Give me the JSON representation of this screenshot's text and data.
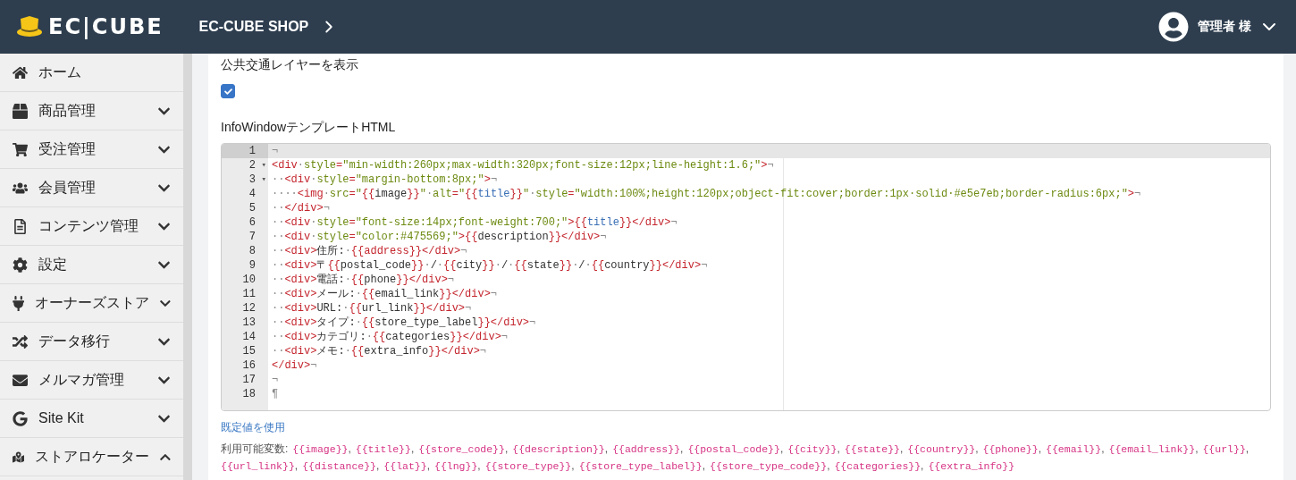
{
  "header": {
    "logo": "EC|CUBE",
    "shop_name": "EC-CUBE SHOP",
    "user": "管理者 様"
  },
  "sidebar": {
    "items": [
      {
        "label": "ホーム",
        "kind": "link"
      },
      {
        "label": "商品管理",
        "kind": "menu",
        "expanded": false
      },
      {
        "label": "受注管理",
        "kind": "menu",
        "expanded": false
      },
      {
        "label": "会員管理",
        "kind": "menu",
        "expanded": false
      },
      {
        "label": "コンテンツ管理",
        "kind": "menu",
        "expanded": false
      },
      {
        "label": "設定",
        "kind": "menu",
        "expanded": false
      },
      {
        "label": "オーナーズストア",
        "kind": "menu",
        "expanded": false
      },
      {
        "label": "データ移行",
        "kind": "menu",
        "expanded": false
      },
      {
        "label": "メルマガ管理",
        "kind": "menu",
        "expanded": false
      },
      {
        "label": "Site Kit",
        "kind": "menu",
        "expanded": false
      },
      {
        "label": "ストアロケーター",
        "kind": "menu",
        "expanded": true
      }
    ]
  },
  "form": {
    "transit_layer": {
      "label": "公共交通レイヤーを表示",
      "checked": true
    },
    "template": {
      "label": "InfoWindowテンプレートHTML",
      "lines": [
        {
          "number": "1",
          "fold": false,
          "active": true,
          "tokens": [
            {
              "kind": "ws",
              "text": "¬"
            }
          ]
        },
        {
          "number": "2",
          "fold": true,
          "active": false,
          "tokens": [
            {
              "kind": "tag",
              "text": "<div"
            },
            {
              "kind": "ws",
              "text": "·"
            },
            {
              "kind": "attr",
              "text": "style"
            },
            {
              "kind": "tag",
              "text": "="
            },
            {
              "kind": "str",
              "text": "\"min-width:260px;max-width:320px;font-size:12px;line-height:1.6;\""
            },
            {
              "kind": "tag",
              "text": ">"
            },
            {
              "kind": "ws",
              "text": "¬"
            }
          ]
        },
        {
          "number": "3",
          "fold": true,
          "active": false,
          "tokens": [
            {
              "kind": "ws",
              "text": "··"
            },
            {
              "kind": "tag",
              "text": "<div"
            },
            {
              "kind": "ws",
              "text": "·"
            },
            {
              "kind": "attr",
              "text": "style"
            },
            {
              "kind": "tag",
              "text": "="
            },
            {
              "kind": "str",
              "text": "\"margin-bottom:8px;\""
            },
            {
              "kind": "tag",
              "text": ">"
            },
            {
              "kind": "ws",
              "text": "¬"
            }
          ]
        },
        {
          "number": "4",
          "fold": false,
          "active": false,
          "tokens": [
            {
              "kind": "ws",
              "text": "····"
            },
            {
              "kind": "tag",
              "text": "<img"
            },
            {
              "kind": "ws",
              "text": "·"
            },
            {
              "kind": "attr",
              "text": "src"
            },
            {
              "kind": "tag",
              "text": "="
            },
            {
              "kind": "str",
              "text": "\""
            },
            {
              "kind": "tag",
              "text": "{{"
            },
            {
              "kind": "text",
              "text": "image"
            },
            {
              "kind": "tag",
              "text": "}}"
            },
            {
              "kind": "str",
              "text": "\""
            },
            {
              "kind": "ws",
              "text": "·"
            },
            {
              "kind": "attr",
              "text": "alt"
            },
            {
              "kind": "tag",
              "text": "="
            },
            {
              "kind": "str",
              "text": "\""
            },
            {
              "kind": "tag",
              "text": "{{"
            },
            {
              "kind": "var",
              "text": "title"
            },
            {
              "kind": "tag",
              "text": "}}"
            },
            {
              "kind": "str",
              "text": "\""
            },
            {
              "kind": "ws",
              "text": "·"
            },
            {
              "kind": "attr",
              "text": "style"
            },
            {
              "kind": "tag",
              "text": "="
            },
            {
              "kind": "str",
              "text": "\"width:100%;height:120px;object-fit:cover;border:1px·solid·#e5e7eb;border-radius:6px;\""
            },
            {
              "kind": "tag",
              "text": ">"
            },
            {
              "kind": "ws",
              "text": "¬"
            }
          ]
        },
        {
          "number": "5",
          "fold": false,
          "active": false,
          "tokens": [
            {
              "kind": "ws",
              "text": "··"
            },
            {
              "kind": "tag",
              "text": "</div>"
            },
            {
              "kind": "ws",
              "text": "¬"
            }
          ]
        },
        {
          "number": "6",
          "fold": false,
          "active": false,
          "tokens": [
            {
              "kind": "ws",
              "text": "··"
            },
            {
              "kind": "tag",
              "text": "<div"
            },
            {
              "kind": "ws",
              "text": "·"
            },
            {
              "kind": "attr",
              "text": "style"
            },
            {
              "kind": "tag",
              "text": "="
            },
            {
              "kind": "str",
              "text": "\"font-size:14px;font-weight:700;\""
            },
            {
              "kind": "tag",
              "text": ">{{"
            },
            {
              "kind": "var",
              "text": "title"
            },
            {
              "kind": "tag",
              "text": "}}</div>"
            },
            {
              "kind": "ws",
              "text": "¬"
            }
          ]
        },
        {
          "number": "7",
          "fold": false,
          "active": false,
          "tokens": [
            {
              "kind": "ws",
              "text": "··"
            },
            {
              "kind": "tag",
              "text": "<div"
            },
            {
              "kind": "ws",
              "text": "·"
            },
            {
              "kind": "attr",
              "text": "style"
            },
            {
              "kind": "tag",
              "text": "="
            },
            {
              "kind": "str",
              "text": "\"color:#475569;\""
            },
            {
              "kind": "tag",
              "text": ">{{"
            },
            {
              "kind": "text",
              "text": "description"
            },
            {
              "kind": "tag",
              "text": "}}</div>"
            },
            {
              "kind": "ws",
              "text": "¬"
            }
          ]
        },
        {
          "number": "8",
          "fold": false,
          "active": false,
          "tokens": [
            {
              "kind": "ws",
              "text": "··"
            },
            {
              "kind": "tag",
              "text": "<div>"
            },
            {
              "kind": "text",
              "text": "住所:"
            },
            {
              "kind": "ws",
              "text": "·"
            },
            {
              "kind": "tag",
              "text": "{{address}}</div>"
            },
            {
              "kind": "ws",
              "text": "¬"
            }
          ]
        },
        {
          "number": "9",
          "fold": false,
          "active": false,
          "tokens": [
            {
              "kind": "ws",
              "text": "··"
            },
            {
              "kind": "tag",
              "text": "<div>"
            },
            {
              "kind": "text",
              "text": "〒"
            },
            {
              "kind": "tag",
              "text": "{{"
            },
            {
              "kind": "text",
              "text": "postal_code"
            },
            {
              "kind": "tag",
              "text": "}}"
            },
            {
              "kind": "ws",
              "text": "·"
            },
            {
              "kind": "text",
              "text": "/"
            },
            {
              "kind": "ws",
              "text": "·"
            },
            {
              "kind": "tag",
              "text": "{{"
            },
            {
              "kind": "text",
              "text": "city"
            },
            {
              "kind": "tag",
              "text": "}}"
            },
            {
              "kind": "ws",
              "text": "·"
            },
            {
              "kind": "text",
              "text": "/"
            },
            {
              "kind": "ws",
              "text": "·"
            },
            {
              "kind": "tag",
              "text": "{{"
            },
            {
              "kind": "text",
              "text": "state"
            },
            {
              "kind": "tag",
              "text": "}}"
            },
            {
              "kind": "ws",
              "text": "·"
            },
            {
              "kind": "text",
              "text": "/"
            },
            {
              "kind": "ws",
              "text": "·"
            },
            {
              "kind": "tag",
              "text": "{{"
            },
            {
              "kind": "text",
              "text": "country"
            },
            {
              "kind": "tag",
              "text": "}}</div>"
            },
            {
              "kind": "ws",
              "text": "¬"
            }
          ]
        },
        {
          "number": "10",
          "fold": false,
          "active": false,
          "tokens": [
            {
              "kind": "ws",
              "text": "··"
            },
            {
              "kind": "tag",
              "text": "<div>"
            },
            {
              "kind": "text",
              "text": "電話:"
            },
            {
              "kind": "ws",
              "text": "·"
            },
            {
              "kind": "tag",
              "text": "{{"
            },
            {
              "kind": "text",
              "text": "phone"
            },
            {
              "kind": "tag",
              "text": "}}</div>"
            },
            {
              "kind": "ws",
              "text": "¬"
            }
          ]
        },
        {
          "number": "11",
          "fold": false,
          "active": false,
          "tokens": [
            {
              "kind": "ws",
              "text": "··"
            },
            {
              "kind": "tag",
              "text": "<div>"
            },
            {
              "kind": "text",
              "text": "メール:"
            },
            {
              "kind": "ws",
              "text": "·"
            },
            {
              "kind": "tag",
              "text": "{{"
            },
            {
              "kind": "text",
              "text": "email_link"
            },
            {
              "kind": "tag",
              "text": "}}</div>"
            },
            {
              "kind": "ws",
              "text": "¬"
            }
          ]
        },
        {
          "number": "12",
          "fold": false,
          "active": false,
          "tokens": [
            {
              "kind": "ws",
              "text": "··"
            },
            {
              "kind": "tag",
              "text": "<div>"
            },
            {
              "kind": "text",
              "text": "URL:"
            },
            {
              "kind": "ws",
              "text": "·"
            },
            {
              "kind": "tag",
              "text": "{{"
            },
            {
              "kind": "text",
              "text": "url_link"
            },
            {
              "kind": "tag",
              "text": "}}</div>"
            },
            {
              "kind": "ws",
              "text": "¬"
            }
          ]
        },
        {
          "number": "13",
          "fold": false,
          "active": false,
          "tokens": [
            {
              "kind": "ws",
              "text": "··"
            },
            {
              "kind": "tag",
              "text": "<div>"
            },
            {
              "kind": "text",
              "text": "タイプ:"
            },
            {
              "kind": "ws",
              "text": "·"
            },
            {
              "kind": "tag",
              "text": "{{"
            },
            {
              "kind": "text",
              "text": "store_type_label"
            },
            {
              "kind": "tag",
              "text": "}}</div>"
            },
            {
              "kind": "ws",
              "text": "¬"
            }
          ]
        },
        {
          "number": "14",
          "fold": false,
          "active": false,
          "tokens": [
            {
              "kind": "ws",
              "text": "··"
            },
            {
              "kind": "tag",
              "text": "<div>"
            },
            {
              "kind": "text",
              "text": "カテゴリ:"
            },
            {
              "kind": "ws",
              "text": "·"
            },
            {
              "kind": "tag",
              "text": "{{"
            },
            {
              "kind": "text",
              "text": "categories"
            },
            {
              "kind": "tag",
              "text": "}}</div>"
            },
            {
              "kind": "ws",
              "text": "¬"
            }
          ]
        },
        {
          "number": "15",
          "fold": false,
          "active": false,
          "tokens": [
            {
              "kind": "ws",
              "text": "··"
            },
            {
              "kind": "tag",
              "text": "<div>"
            },
            {
              "kind": "text",
              "text": "メモ:"
            },
            {
              "kind": "ws",
              "text": "·"
            },
            {
              "kind": "tag",
              "text": "{{"
            },
            {
              "kind": "text",
              "text": "extra_info"
            },
            {
              "kind": "tag",
              "text": "}}</div>"
            },
            {
              "kind": "ws",
              "text": "¬"
            }
          ]
        },
        {
          "number": "16",
          "fold": false,
          "active": false,
          "tokens": [
            {
              "kind": "tag",
              "text": "</div>"
            },
            {
              "kind": "ws",
              "text": "¬"
            }
          ]
        },
        {
          "number": "17",
          "fold": false,
          "active": false,
          "tokens": [
            {
              "kind": "ws",
              "text": "¬"
            }
          ]
        },
        {
          "number": "18",
          "fold": false,
          "active": false,
          "tokens": [
            {
              "kind": "ws",
              "text": "¶"
            }
          ]
        }
      ],
      "fold_marker": "▾",
      "reset_link": "既定値を使用",
      "separator": ",",
      "variables_label": "利用可能変数:",
      "variables": [
        "{{image}}",
        "{{title}}",
        "{{store_code}}",
        "{{description}}",
        "{{address}}",
        "{{postal_code}}",
        "{{city}}",
        "{{state}}",
        "{{country}}",
        "{{phone}}",
        "{{email}}",
        "{{email_link}}",
        "{{url}}",
        "{{url_link}}",
        "{{distance}}",
        "{{lat}}",
        "{{lng}}",
        "{{store_type}}",
        "{{store_type_label}}",
        "{{store_type_code}}",
        "{{categories}}",
        "{{extra_info}}"
      ]
    }
  }
}
